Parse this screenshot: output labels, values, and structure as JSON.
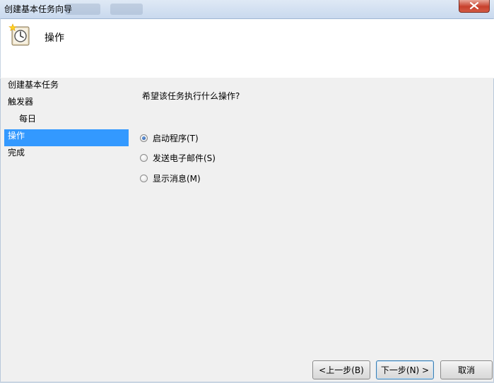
{
  "window": {
    "title": "创建基本任务向导"
  },
  "header": {
    "title": "操作",
    "icon": "scheduled-task-clock-icon"
  },
  "nav": {
    "items": [
      {
        "label": "创建基本任务",
        "selected": false,
        "sub": false
      },
      {
        "label": "触发器",
        "selected": false,
        "sub": false
      },
      {
        "label": "每日",
        "selected": false,
        "sub": true
      },
      {
        "label": "操作",
        "selected": true,
        "sub": false
      },
      {
        "label": "完成",
        "selected": false,
        "sub": false
      }
    ]
  },
  "content": {
    "question": "希望该任务执行什么操作?",
    "options": [
      {
        "label": "启动程序(T)",
        "checked": true
      },
      {
        "label": "发送电子邮件(S)",
        "checked": false
      },
      {
        "label": "显示消息(M)",
        "checked": false
      }
    ]
  },
  "buttons": {
    "back": "<上一步(B)",
    "next": "下一步(N) >",
    "cancel": "取消"
  },
  "colors": {
    "selection": "#3399ff",
    "background": "#f0f0f0",
    "header_background": "#ffffff",
    "close_button": "#c7402c"
  }
}
